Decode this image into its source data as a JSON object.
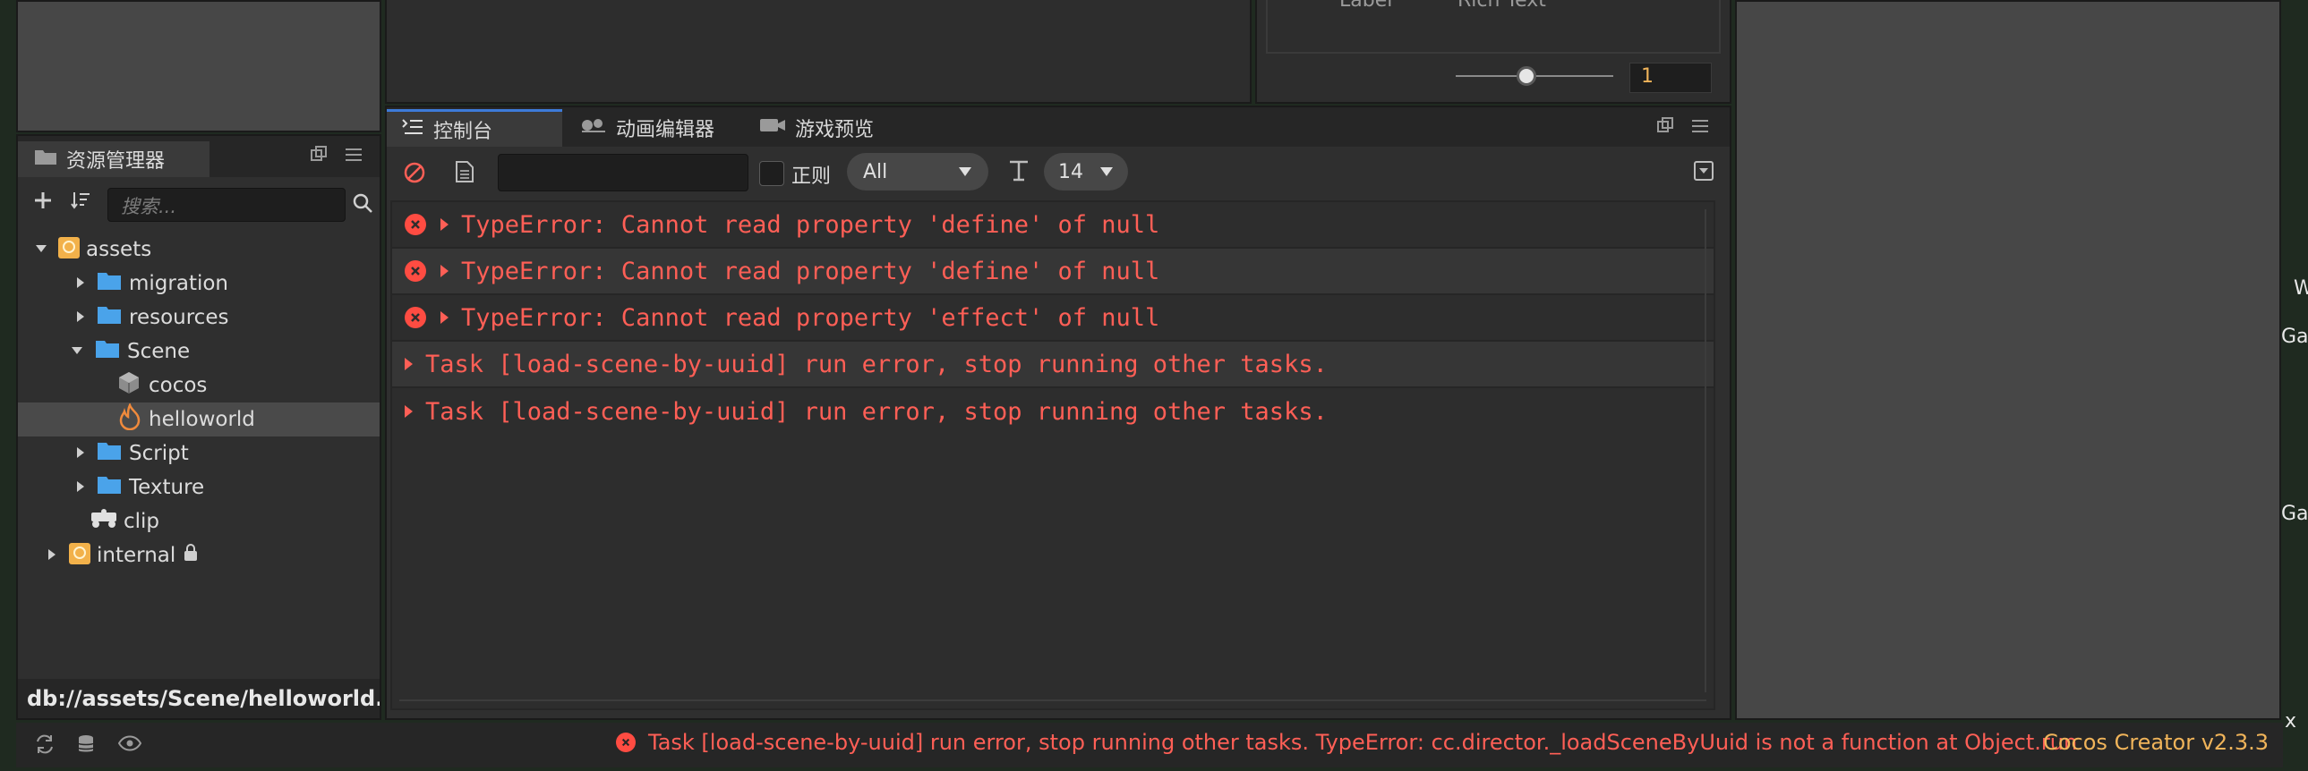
{
  "assets": {
    "tab_label": "资源管理器",
    "search_placeholder": "搜索...",
    "tree": [
      {
        "label": "assets",
        "type": "db",
        "expanded": true
      },
      {
        "label": "migration",
        "type": "folder"
      },
      {
        "label": "resources",
        "type": "folder"
      },
      {
        "label": "Scene",
        "type": "folder",
        "expanded": true
      },
      {
        "label": "cocos",
        "type": "prefab"
      },
      {
        "label": "helloworld",
        "type": "scene",
        "selected": true
      },
      {
        "label": "Script",
        "type": "folder"
      },
      {
        "label": "Texture",
        "type": "folder"
      },
      {
        "label": "clip",
        "type": "anim"
      },
      {
        "label": "internal",
        "type": "db",
        "locked": true
      }
    ],
    "path": "db://assets/Scene/helloworld.f..."
  },
  "inspector_top": {
    "label_1": "Label",
    "label_2": "Rich Text",
    "slider_value": "1"
  },
  "console": {
    "tabs": [
      {
        "label": "控制台",
        "active": true
      },
      {
        "label": "动画编辑器"
      },
      {
        "label": "游戏预览"
      }
    ],
    "regex_label": "正则",
    "level_filter": "All",
    "font_size": "14",
    "logs": [
      {
        "text": "TypeError: Cannot read property 'define' of null",
        "icon": true
      },
      {
        "text": "TypeError: Cannot read property 'define' of null",
        "icon": true
      },
      {
        "text": "TypeError: Cannot read property 'effect' of null",
        "icon": true
      },
      {
        "text": "Task [load-scene-by-uuid] run error, stop running other tasks.",
        "icon": false
      },
      {
        "text": "Task [load-scene-by-uuid] run error, stop running other tasks.",
        "icon": false
      }
    ]
  },
  "status": {
    "message": "Task [load-scene-by-uuid] run error, stop running other tasks. TypeError: cc.director._loadSceneByUuid is not a function at Object.run",
    "version": "Cocos Creator v2.3.3"
  },
  "edge": {
    "w": "W",
    "ga1": "Ga",
    "ga2": "Ga",
    "x": "x"
  },
  "colors": {
    "error": "#ff5f56",
    "accent": "#3d7bd9",
    "version": "#f0b45a",
    "folder": "#4aa3ea",
    "db": "#f2b14a"
  }
}
